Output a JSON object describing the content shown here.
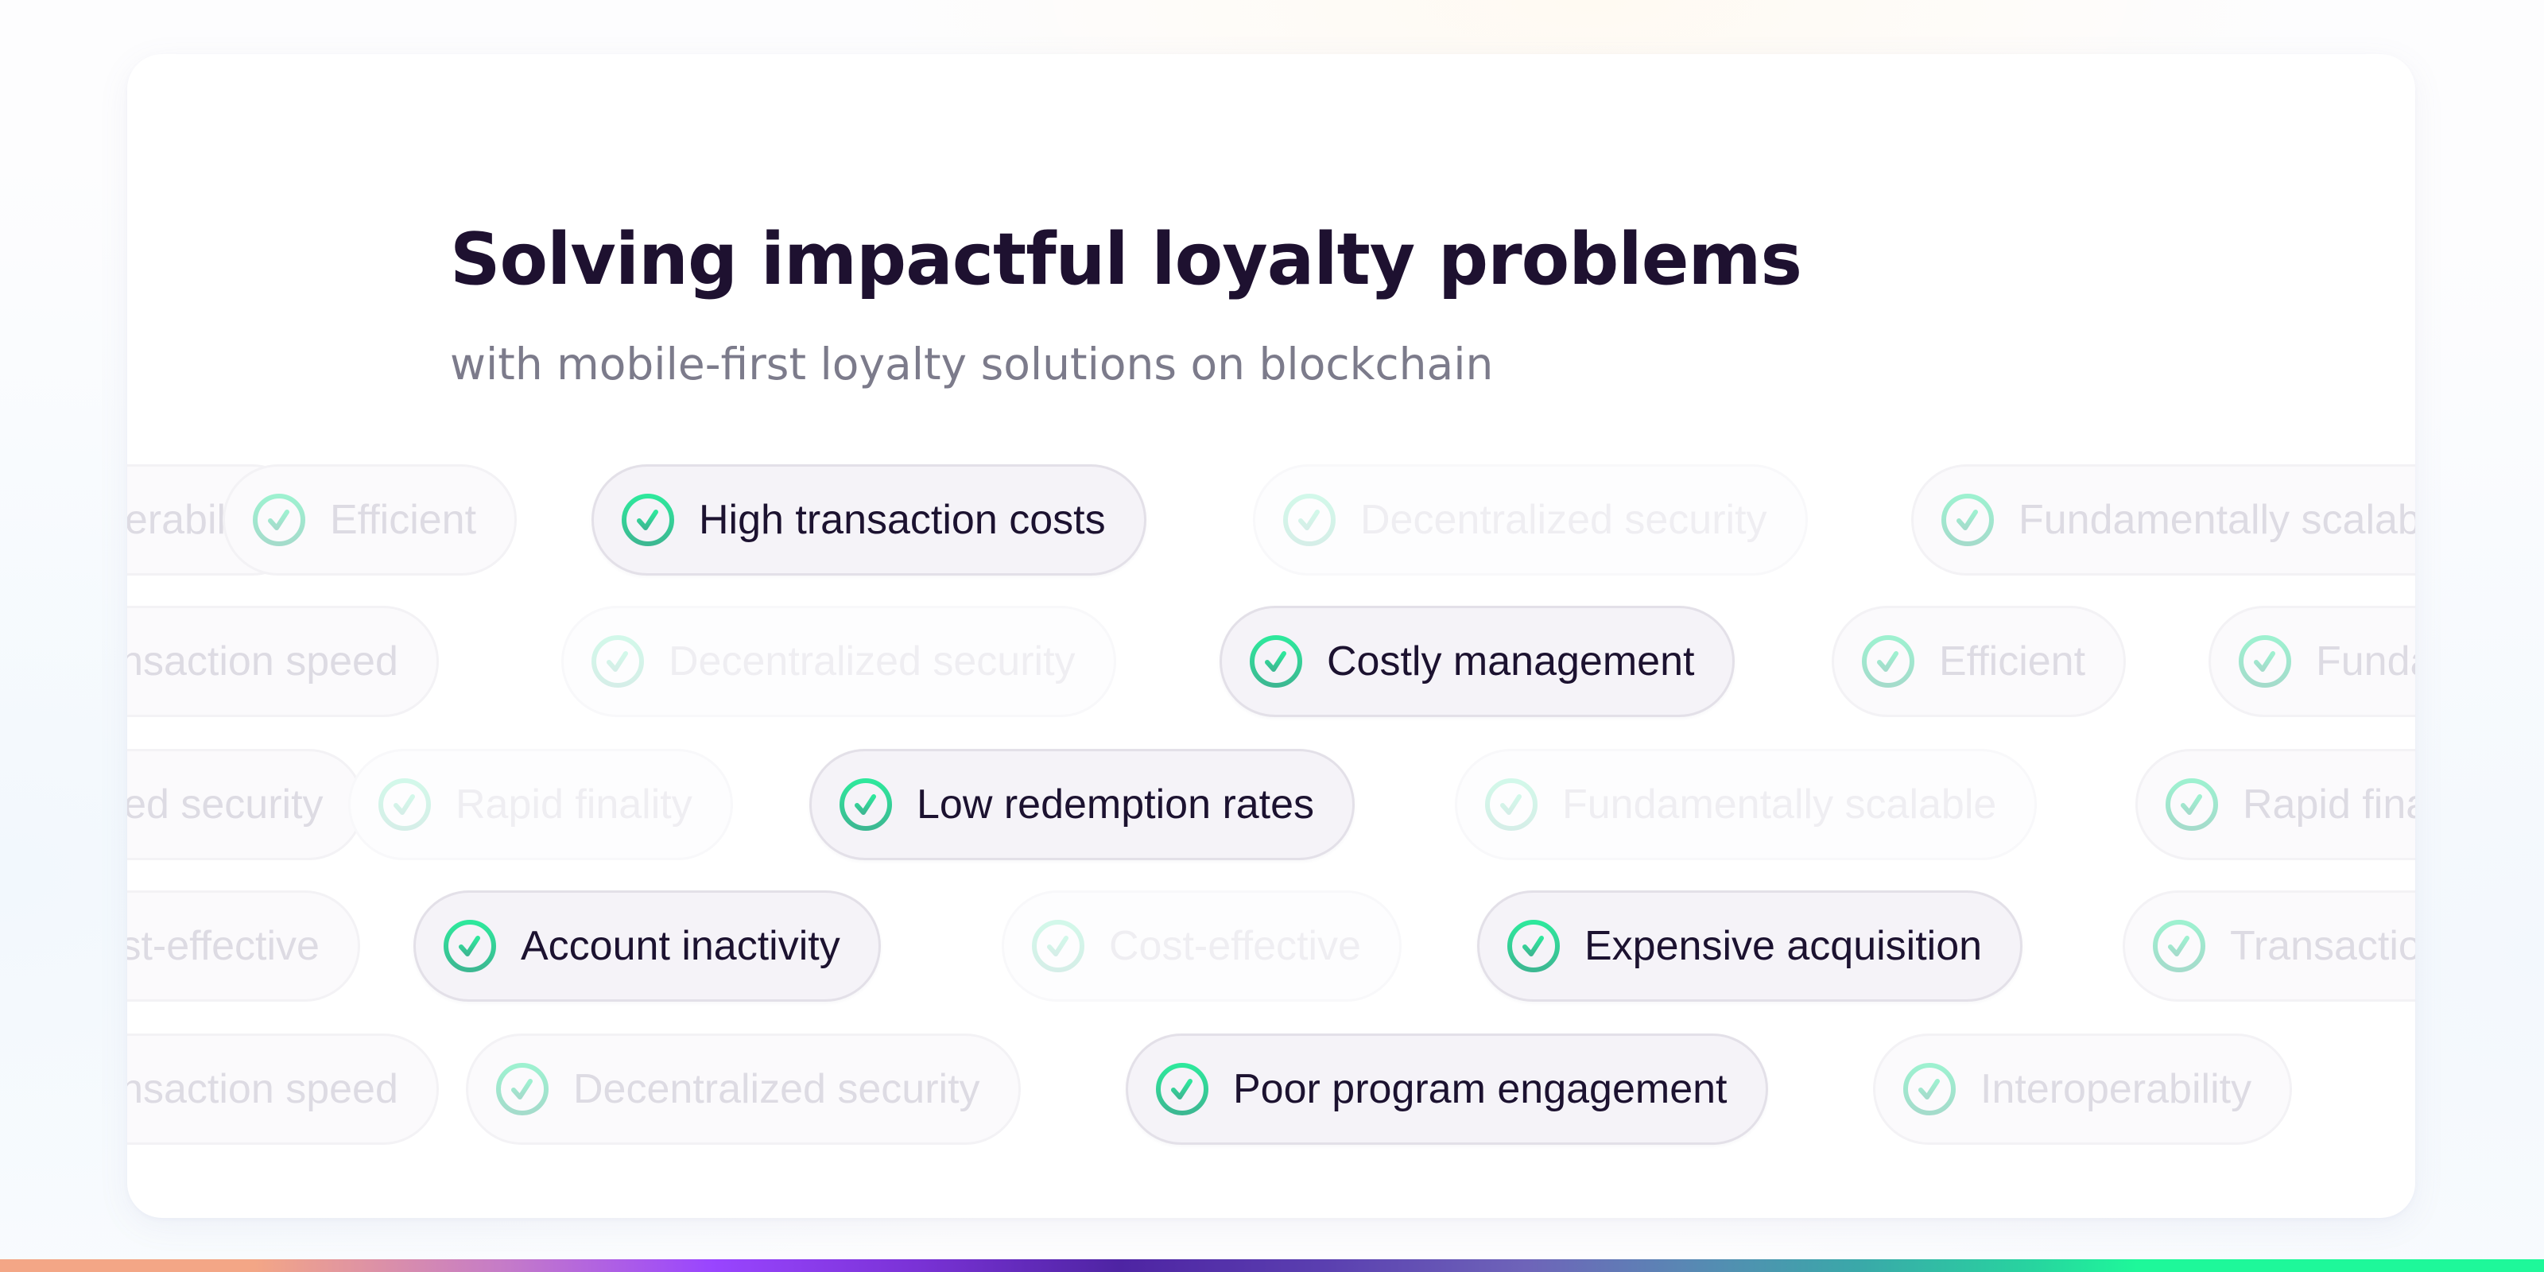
{
  "header": {
    "title": "Solving impactful loyalty problems",
    "subtitle": "with mobile-first loyalty solutions on blockchain"
  },
  "colors": {
    "title": "#1e1130",
    "subtitle": "#7c7b8b",
    "check_gradient_top": "#2ee89c",
    "check_gradient_bottom": "#3cb892",
    "chip_active_bg": "#f5f3f8",
    "bottom_bar_stops": [
      "#f3a686",
      "#9945ff",
      "#4e24a3",
      "#6e64b9",
      "#3aa8a9",
      "#1ef89a"
    ]
  },
  "chip_rows": [
    {
      "chips": [
        {
          "label": "Interoperability",
          "state": "faded",
          "icon": "check-circle-icon"
        },
        {
          "label": "Efficient",
          "state": "faded",
          "icon": "check-circle-icon"
        },
        {
          "label": "High transaction costs",
          "state": "active",
          "icon": "check-circle-icon"
        },
        {
          "label": "Decentralized security",
          "state": "ghost",
          "icon": "check-circle-icon"
        },
        {
          "label": "Fundamentally scalable",
          "state": "faded",
          "icon": "check-circle-icon"
        }
      ]
    },
    {
      "chips": [
        {
          "label": "Transaction speed",
          "state": "faded",
          "icon": "check-circle-icon"
        },
        {
          "label": "Decentralized security",
          "state": "ghost",
          "icon": "check-circle-icon"
        },
        {
          "label": "Costly management",
          "state": "active",
          "icon": "check-circle-icon"
        },
        {
          "label": "Efficient",
          "state": "faded",
          "icon": "check-circle-icon"
        },
        {
          "label": "Fundamentally scalable",
          "state": "faded",
          "icon": "check-circle-icon"
        }
      ]
    },
    {
      "chips": [
        {
          "label": "Decentralized security",
          "state": "faded",
          "icon": "check-circle-icon"
        },
        {
          "label": "Rapid finality",
          "state": "ghost",
          "icon": "check-circle-icon"
        },
        {
          "label": "Low redemption rates",
          "state": "active",
          "icon": "check-circle-icon"
        },
        {
          "label": "Fundamentally scalable",
          "state": "ghost",
          "icon": "check-circle-icon"
        },
        {
          "label": "Rapid finality",
          "state": "faded",
          "icon": "check-circle-icon"
        }
      ]
    },
    {
      "chips": [
        {
          "label": "Cost-effective",
          "state": "faded",
          "icon": "check-circle-icon"
        },
        {
          "label": "Account inactivity",
          "state": "active",
          "icon": "check-circle-icon"
        },
        {
          "label": "Cost-effective",
          "state": "ghost",
          "icon": "check-circle-icon"
        },
        {
          "label": "Expensive acquisition",
          "state": "active",
          "icon": "check-circle-icon"
        },
        {
          "label": "Transaction speed",
          "state": "faded",
          "icon": "check-circle-icon"
        }
      ]
    },
    {
      "chips": [
        {
          "label": "Transaction speed",
          "state": "faded",
          "icon": "check-circle-icon"
        },
        {
          "label": "Decentralized security",
          "state": "faded",
          "icon": "check-circle-icon"
        },
        {
          "label": "Poor program engagement",
          "state": "active",
          "icon": "check-circle-icon"
        },
        {
          "label": "Interoperability",
          "state": "faded",
          "icon": "check-circle-icon"
        }
      ]
    }
  ]
}
